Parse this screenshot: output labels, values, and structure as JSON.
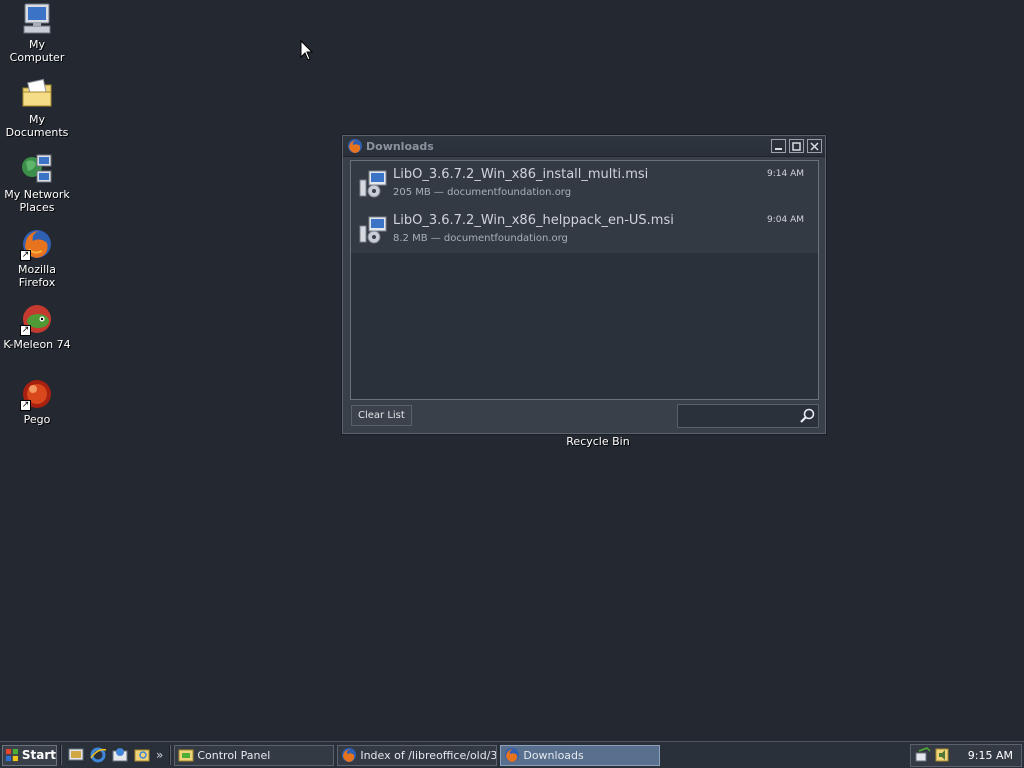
{
  "desktop": {
    "icons": [
      {
        "label": "My Computer",
        "icon": "my-computer-icon"
      },
      {
        "label": "My Documents",
        "icon": "my-documents-icon"
      },
      {
        "label": "My Network Places",
        "icon": "network-places-icon"
      },
      {
        "label": "Mozilla Firefox",
        "icon": "firefox-icon"
      },
      {
        "label": "K-Meleon 74",
        "icon": "kmeleon-icon"
      },
      {
        "label": "Pego",
        "icon": "pego-icon"
      }
    ],
    "recycle_bin_label": "Recycle Bin"
  },
  "downloads_window": {
    "title": "Downloads",
    "items": [
      {
        "filename": "LibO_3.6.7.2_Win_x86_install_multi.msi",
        "meta": "205 MB — documentfoundation.org",
        "time": "9:14 AM"
      },
      {
        "filename": "LibO_3.6.7.2_Win_x86_helppack_en-US.msi",
        "meta": "8.2 MB — documentfoundation.org",
        "time": "9:04 AM"
      }
    ],
    "clear_list_label": "Clear List",
    "search_value": ""
  },
  "taskbar": {
    "start_label": "Start",
    "quick_launch_more": "»",
    "tasks": [
      {
        "label": "Control Panel",
        "icon": "control-panel-icon",
        "active": false
      },
      {
        "label": "Index of /libreoffice/old/3...",
        "icon": "firefox-icon",
        "active": false
      },
      {
        "label": "Downloads",
        "icon": "firefox-icon",
        "active": true
      }
    ],
    "clock": "9:15 AM"
  },
  "colors": {
    "desktop_bg": "#232831",
    "window_bg": "#3a4049",
    "active_task": "#58708e"
  }
}
